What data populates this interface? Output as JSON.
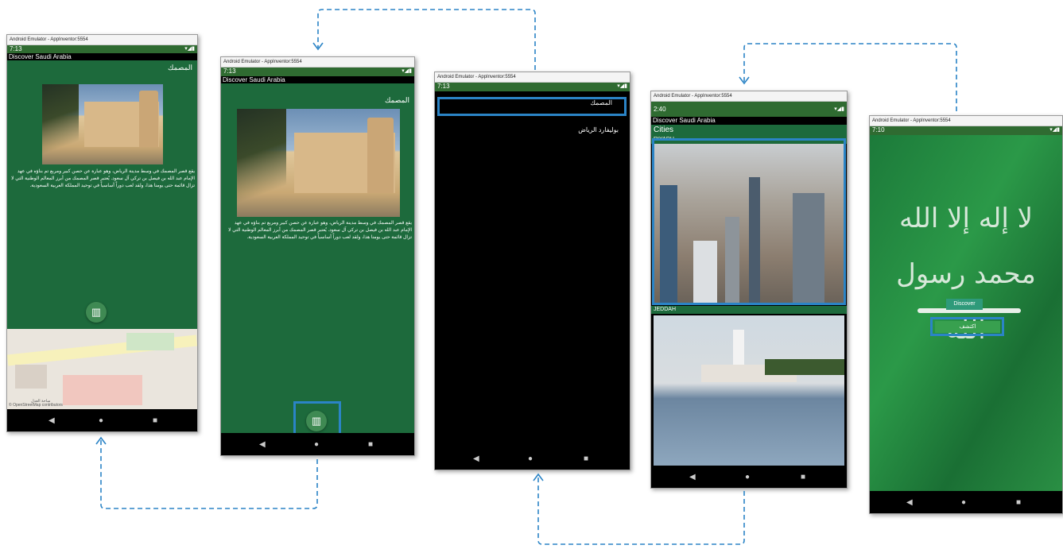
{
  "emulator_title": "Android Emulator - AppInventor:5554",
  "app_title": "Discover Saudi Arabia",
  "nav_icons": {
    "back": "◀",
    "home": "●",
    "recents": "■"
  },
  "status_icons": "▾◢▮",
  "screen1": {
    "time": "7:13",
    "heading": "المصمك",
    "description": "يقع قصر المصمك في وسط مدينة الرياض، وهو عبارة عن حصن كبير ومربع تم بناؤه في عهد الإمام عبد الله بن فيصل بن تركي آل سعود. يُعتبر قصر المصمك من أبرز المعالم الوطنية التي لا تزال قائمة حتى يومنا هذا، ولقد لعب دوراً أساسياً في توحيد المملكة العربية السعودية.",
    "map_attribution": "© OpenStreetMap contributors",
    "map_label": "ساحة العدل",
    "map_icon": "map-icon"
  },
  "screen2": {
    "time": "7:13",
    "heading": "المصمك",
    "description": "يقع قصر المصمك في وسط مدينة الرياض، وهو عبارة عن حصن كبير ومربع تم بناؤه في عهد الإمام عبد الله بن فيصل بن تركي آل سعود. يُعتبر قصر المصمك من أبرز المعالم الوطنية التي لا تزال قائمة حتى يومنا هذا، ولقد لعب دوراً أساسياً في توحيد المملكة العربية السعودية."
  },
  "screen3": {
    "time": "7:13",
    "list_items": [
      "المصمك",
      "بوليفارد الرياض"
    ]
  },
  "screen4": {
    "time": "2:40",
    "section_label": "Cities",
    "cities": [
      "RIYADH",
      "JEDDAH"
    ]
  },
  "screen5": {
    "time": "7:10",
    "flag_text": "لا إله إلا الله محمد رسول الله",
    "discover_label": "Discover",
    "discover_ar_label": "اكتشف"
  },
  "colors": {
    "status_bar": "#2f6b31",
    "app_background": "#1d6a3c",
    "highlight": "#2b84c6",
    "arrow": "#2b84c6"
  }
}
